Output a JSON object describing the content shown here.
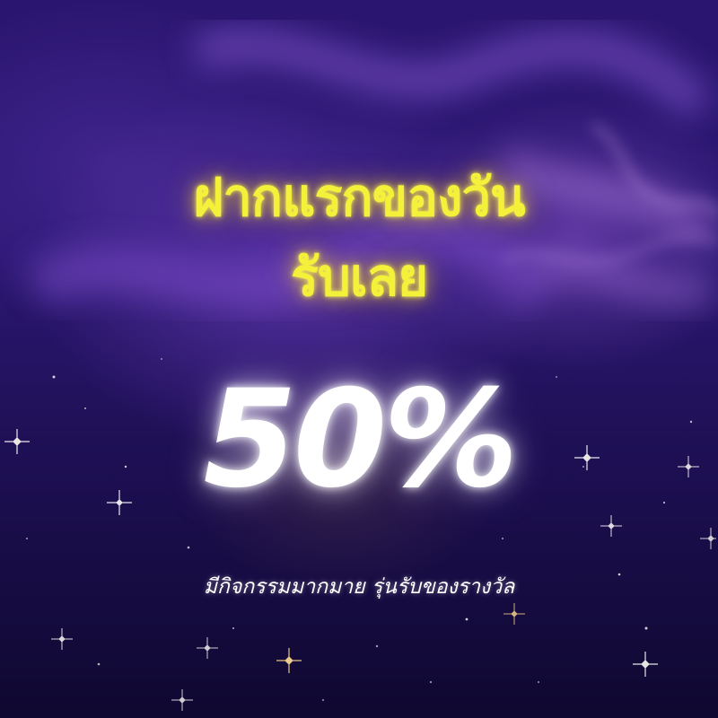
{
  "promo": {
    "headline_line1": "ฝากแรกของวัน",
    "headline_line2": "รับเลย",
    "bonus_percent": "50%",
    "subtitle": "มีกิจกรรมมากมาย รุ่นรับของรางวัล"
  },
  "colors": {
    "headline": "#f4f13a",
    "percent": "#ffffff",
    "background_top": "#2a1670",
    "background_bottom": "#0f0830"
  }
}
